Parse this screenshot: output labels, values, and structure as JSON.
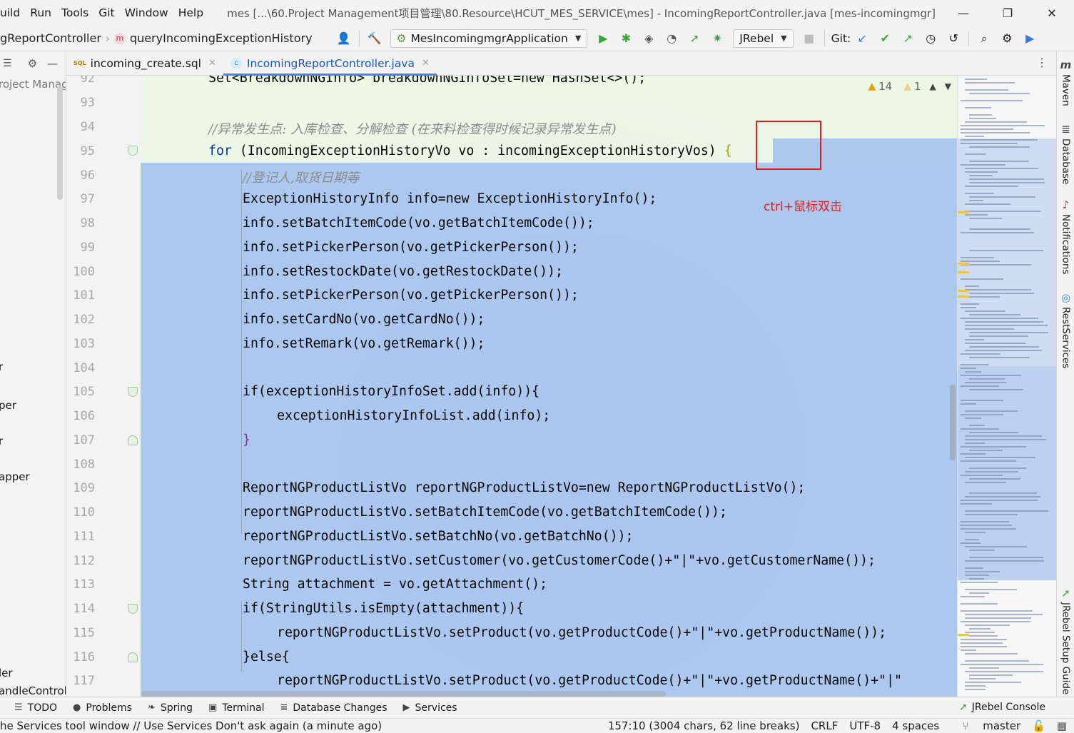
{
  "menu": {
    "items": [
      "uild",
      "Run",
      "Tools",
      "Git",
      "Window",
      "Help"
    ],
    "window_title": "mes [...\\60.Project Management项目管理\\80.Resource\\HCUT_MES_SERVICE\\mes] - IncomingReportController.java [mes-incomingmgr]"
  },
  "nav": {
    "breadcrumb_class": "gReportController",
    "breadcrumb_method": "queryIncomingExceptionHistory",
    "run_config": "MesIncomingmgrApplication",
    "jrebel_label": "JRebel",
    "git_label": "Git:"
  },
  "project_panel": {
    "title": "roject Manag",
    "tree_labels": [
      "r",
      "per",
      "r",
      "apper",
      "ler",
      "andleControl"
    ]
  },
  "tabs": [
    {
      "label": "incoming_create.sql",
      "type": "sql"
    },
    {
      "label": "IncomingReportController.java",
      "type": "class"
    }
  ],
  "editor": {
    "inspections": {
      "warnings": "14",
      "weak_warnings": "1"
    },
    "annotation_label": "ctrl+鼠标双击",
    "line_numbers": [
      "92",
      "93",
      "94",
      "95",
      "96",
      "97",
      "98",
      "99",
      "100",
      "101",
      "102",
      "103",
      "104",
      "105",
      "106",
      "107",
      "108",
      "109",
      "110",
      "111",
      "112",
      "113",
      "114",
      "115",
      "116",
      "117"
    ],
    "lines": {
      "l92": "Set<BreakdownNGInfo> breakdownNGInfoSet=new HashSet<>();",
      "l94": "//异常发生点: 入库检查、分解检查 (在来料检查得时候记录异常发生点)",
      "l95_kw": "for",
      "l95_rest": " (IncomingExceptionHistoryVo vo : incomingExceptionHistoryVos)",
      "l95_brace": " {",
      "l96": "//登记人,取货日期等",
      "l97": "ExceptionHistoryInfo info=new ExceptionHistoryInfo();",
      "l98": "info.setBatchItemCode(vo.getBatchItemCode());",
      "l99": "info.setPickerPerson(vo.getPickerPerson());",
      "l100": "info.setRestockDate(vo.getRestockDate());",
      "l101": "info.setPickerPerson(vo.getPickerPerson());",
      "l102": "info.setCardNo(vo.getCardNo());",
      "l103": "info.setRemark(vo.getRemark());",
      "l105": "if(exceptionHistoryInfoSet.add(info)){",
      "l106": "exceptionHistoryInfoList.add(info);",
      "l107": "}",
      "l109": "ReportNGProductListVo reportNGProductListVo=new ReportNGProductListVo();",
      "l110": "reportNGProductListVo.setBatchItemCode(vo.getBatchItemCode());",
      "l111": "reportNGProductListVo.setBatchNo(vo.getBatchNo());",
      "l112": "reportNGProductListVo.setCustomer(vo.getCustomerCode()+\"|\"+vo.getCustomerName());",
      "l113": "String attachment = vo.getAttachment();",
      "l114": "if(StringUtils.isEmpty(attachment)){",
      "l115": "reportNGProductListVo.setProduct(vo.getProductCode()+\"|\"+vo.getProductName());",
      "l116": "}else{",
      "l117": "reportNGProductListVo.setProduct(vo.getProductCode()+\"|\"+vo.getProductName()+\"|\""
    }
  },
  "right_tools": [
    "Maven",
    "Database",
    "Notifications",
    "RestServices",
    "JRebel Setup Guide"
  ],
  "bottom_tools": [
    "TODO",
    "Problems",
    "Spring",
    "Terminal",
    "Database Changes",
    "Services"
  ],
  "jrebel_console": "JRebel Console",
  "status": {
    "message": "he Services tool window // Use Services   Don't ask again (a minute ago)",
    "position": "157:10 (3004 chars, 62 line breaks)",
    "line_sep": "CRLF",
    "encoding": "UTF-8",
    "indent": "4 spaces",
    "branch": "master"
  },
  "colors": {
    "selection": "#a6c3ee",
    "keyword": "#0033b3",
    "comment": "#8c8c8c",
    "annotation_red": "#e02020",
    "active_tab": "#1a56c0"
  }
}
